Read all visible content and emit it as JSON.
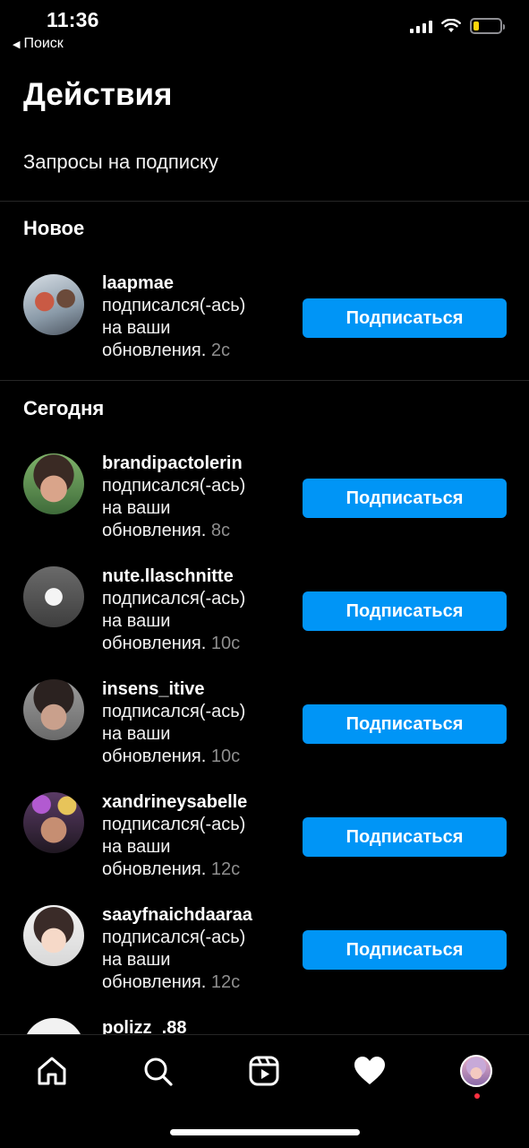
{
  "status_bar": {
    "time": "11:36",
    "back_label": "Поиск",
    "battery_color": "#ffd60a"
  },
  "header": {
    "title": "Действия",
    "requests_link": "Запросы на подписку"
  },
  "sections": {
    "new_title": "Новое",
    "today_title": "Сегодня"
  },
  "accent_color": "#0095f6",
  "new_items": [
    {
      "username": "laapmae",
      "text_line1": "подписался(-ась)",
      "text_line2": "на ваши",
      "text_line3": "обновления.",
      "time": "2с",
      "button": "Подписаться"
    }
  ],
  "today_items": [
    {
      "username": "brandipactolerin",
      "text_line1": "подписался(-ась)",
      "text_line2": "на ваши",
      "text_line3": "обновления.",
      "time": "8с",
      "button": "Подписаться"
    },
    {
      "username": "nute.llaschnitte",
      "text_line1": "подписался(-ась)",
      "text_line2": "на ваши",
      "text_line3": "обновления.",
      "time": "10с",
      "button": "Подписаться"
    },
    {
      "username": "insens_itive",
      "text_line1": "подписался(-ась)",
      "text_line2": "на ваши",
      "text_line3": "обновления.",
      "time": "10с",
      "button": "Подписаться"
    },
    {
      "username": "xandrineysabelle",
      "text_line1": "подписался(-ась)",
      "text_line2": "на ваши",
      "text_line3": "обновления.",
      "time": "12с",
      "button": "Подписаться"
    },
    {
      "username": "saayfnaichdaaraa",
      "text_line1": "подписался(-ась)",
      "text_line2": "на ваши",
      "text_line3": "обновления.",
      "time": "12с",
      "button": "Подписаться"
    },
    {
      "username": "polizz_.88"
    }
  ],
  "tab_bar": {
    "icons": [
      "home-icon",
      "search-icon",
      "reels-icon",
      "heart-icon",
      "profile-avatar"
    ]
  }
}
